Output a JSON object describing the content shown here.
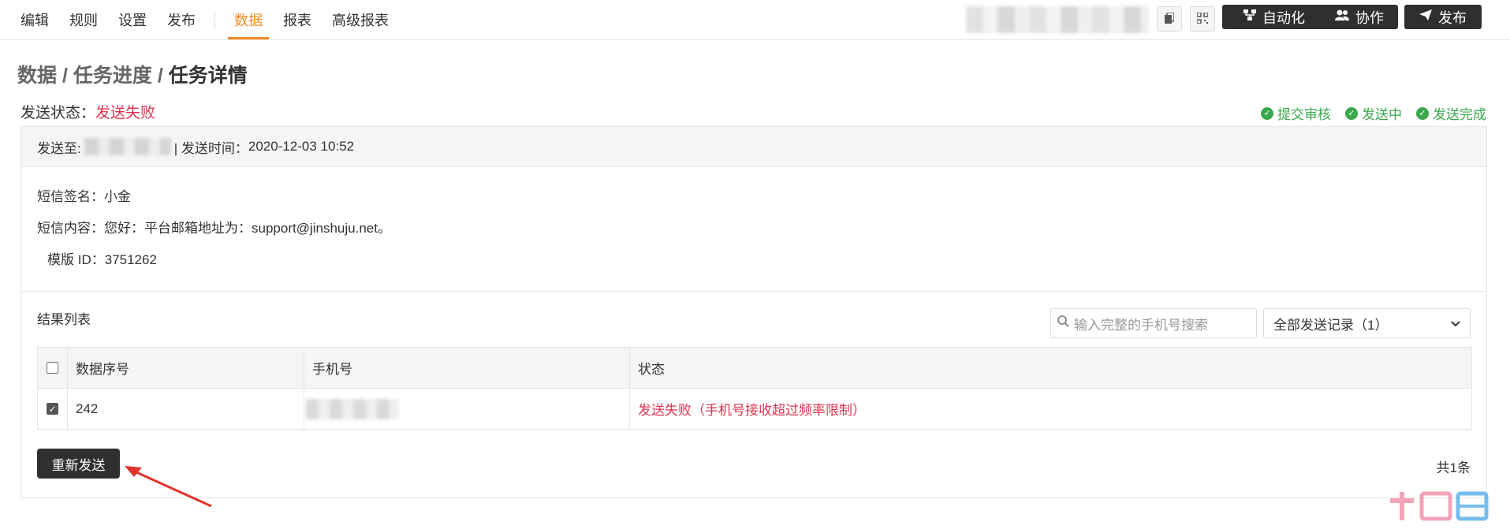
{
  "nav": {
    "items": [
      "编辑",
      "规则",
      "设置",
      "发布"
    ],
    "tabs": [
      "数据",
      "报表",
      "高级报表"
    ],
    "active_tab": "数据"
  },
  "toolbar": {
    "automation_label": "自动化",
    "collab_label": "协作",
    "publish_label": "发布"
  },
  "breadcrumb": {
    "part1": "数据",
    "part2": "任务进度",
    "current": "任务详情",
    "separator": "/"
  },
  "status": {
    "label": "发送状态：",
    "value": "发送失败"
  },
  "steps": [
    "提交审核",
    "发送中",
    "发送完成"
  ],
  "send_info": {
    "to_label": "发送至:",
    "time_label": "| 发送时间：",
    "time_value": "2020-12-03 10:52"
  },
  "sms": {
    "signature_label": "短信签名：",
    "signature_value": "小金",
    "content_label": "短信内容：",
    "content_value": "您好：平台邮箱地址为：support@jinshuju.net。",
    "template_label": "模版 ID：",
    "template_value": "3751262"
  },
  "results": {
    "title": "结果列表",
    "search_placeholder": "输入完整的手机号搜索",
    "filter_value": "全部发送记录（1）",
    "columns": [
      "数据序号",
      "手机号",
      "状态"
    ],
    "rows": [
      {
        "serial": "242",
        "status": "发送失败（手机号接收超过频率限制）",
        "checked": true
      }
    ],
    "resend_label": "重新发送",
    "total": "共1条"
  },
  "colors": {
    "accent": "#f08a24",
    "fail": "#e0334f",
    "success": "#3aa84d",
    "dark_button": "#2f2f2f"
  }
}
